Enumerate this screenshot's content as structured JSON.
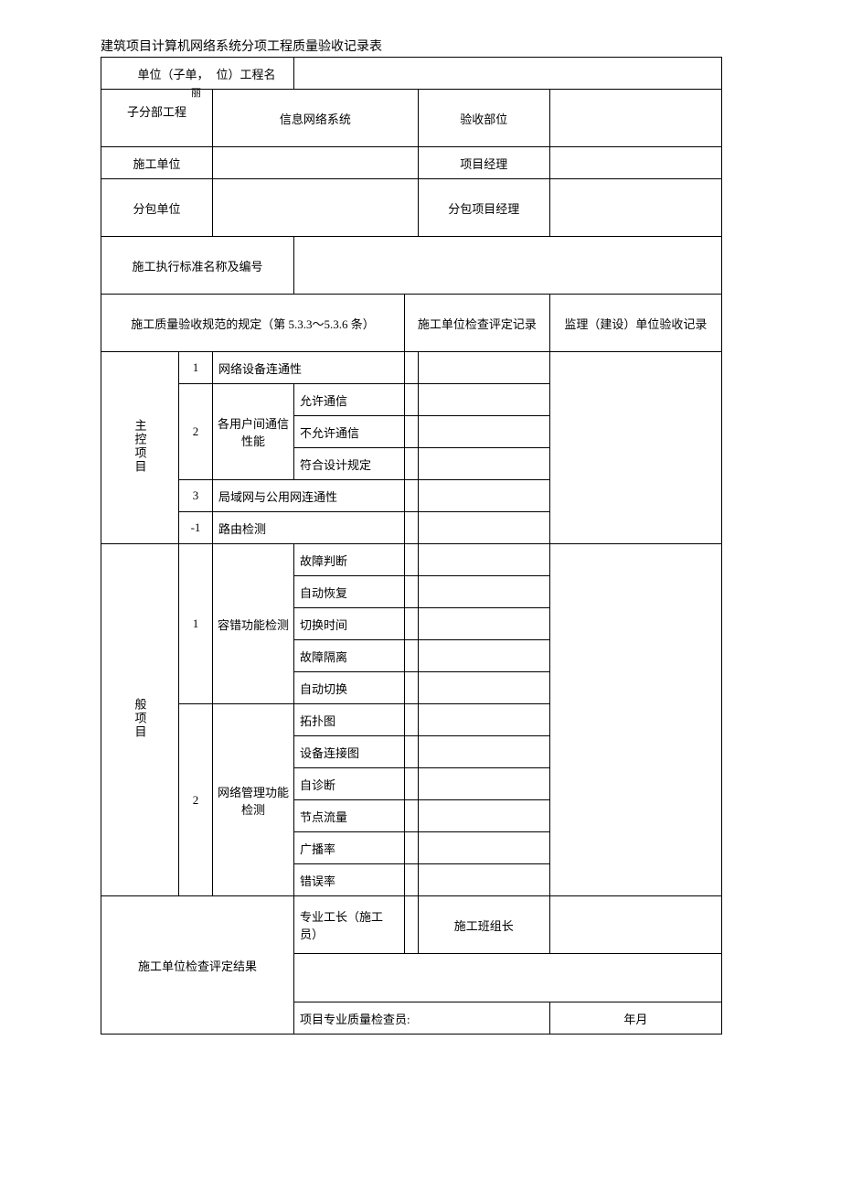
{
  "title": "建筑项目计算机网络系统分项工程质量验收记录表",
  "header": {
    "unit_label_a": "单位（子单，",
    "unit_label_b": "位）工程名",
    "unit_label_c": "丽",
    "sub_label": "子分部工程",
    "sub_value": "信息网络系统",
    "accept_part_label": "验收部位",
    "constructor_label": "施工单位",
    "pm_label": "项目经理",
    "subcontractor_label": "分包单位",
    "sub_pm_label": "分包项目经理",
    "standard_label": "施工执行标准名称及编号",
    "spec_label": "施工质量验收规范的规定（第 5.3.3～5.3.6 条）",
    "check_record_label": "施工单位检查评定记录",
    "supervisor_record_label": "监理（建设）单位验收记录"
  },
  "main_ctrl": {
    "title": "主控项目",
    "r1_num": "1",
    "r1_label": "网络设备连通性",
    "r2_num": "2",
    "r2_label": "各用户间通信性能",
    "r2_a": "允许通信",
    "r2_b": "不允许通信",
    "r2_c": "符合设计规定",
    "r3_num": "3",
    "r3_label": "局域网与公用网连通性",
    "r4_num": "-1",
    "r4_label": "路由检测"
  },
  "general": {
    "title": "般项目",
    "r1_num": "1",
    "r1_label": "容错功能检测",
    "r1_a": "故障判断",
    "r1_b": "自动恢复",
    "r1_c": "切换时间",
    "r1_d": "故障隔离",
    "r1_e": "自动切换",
    "r2_num": "2",
    "r2_label": "网络管理功能检测",
    "r2_a": "拓扑图",
    "r2_b": "设备连接图",
    "r2_c": "自诊断",
    "r2_d": "节点流量",
    "r2_e": "广播率",
    "r2_f": "错误率"
  },
  "footer": {
    "result_label": "施工单位检查评定结果",
    "foreman_label": "专业工长（施工员）",
    "team_leader_label": "施工班组长",
    "inspector_label": "项目专业质量检查员:",
    "date_label": "年月"
  }
}
